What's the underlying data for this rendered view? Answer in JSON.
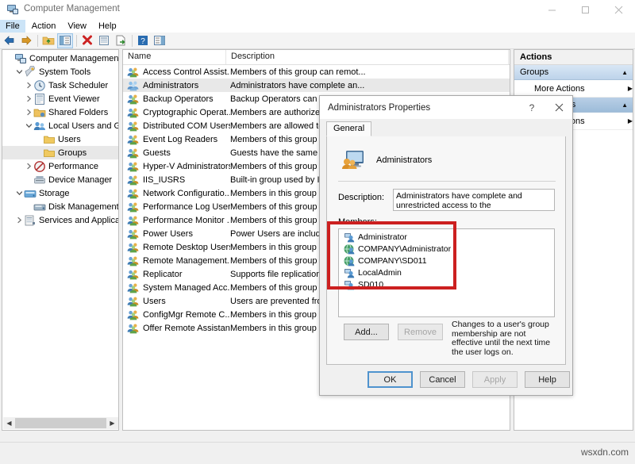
{
  "window": {
    "title": "Computer Management",
    "icon": "computer-management-icon",
    "minimize": "—",
    "maximize": "□",
    "close": "✕"
  },
  "menubar": {
    "items": [
      {
        "label": "File",
        "active": true
      },
      {
        "label": "Action",
        "active": false
      },
      {
        "label": "View",
        "active": false
      },
      {
        "label": "Help",
        "active": false
      }
    ]
  },
  "toolbar": {
    "buttons": [
      {
        "name": "back-icon"
      },
      {
        "name": "forward-icon"
      },
      {
        "name": "up-folder-icon"
      },
      {
        "name": "show-hide-console-tree-icon"
      },
      {
        "name": "delete-icon"
      },
      {
        "name": "properties-icon"
      },
      {
        "name": "export-list-icon"
      },
      {
        "name": "help-icon"
      },
      {
        "name": "show-action-pane-icon"
      }
    ]
  },
  "tree": {
    "nodes": [
      {
        "label": "Computer Management (Local",
        "depth": 0,
        "twisty": "none",
        "icon": "computer-icon",
        "selected": false
      },
      {
        "label": "System Tools",
        "depth": 1,
        "twisty": "expanded",
        "icon": "tools-icon",
        "selected": false
      },
      {
        "label": "Task Scheduler",
        "depth": 2,
        "twisty": "collapsed",
        "icon": "clock-icon",
        "selected": false
      },
      {
        "label": "Event Viewer",
        "depth": 2,
        "twisty": "collapsed",
        "icon": "event-viewer-icon",
        "selected": false
      },
      {
        "label": "Shared Folders",
        "depth": 2,
        "twisty": "collapsed",
        "icon": "shared-folders-icon",
        "selected": false
      },
      {
        "label": "Local Users and Groups",
        "depth": 2,
        "twisty": "expanded",
        "icon": "users-groups-icon",
        "selected": false
      },
      {
        "label": "Users",
        "depth": 3,
        "twisty": "none",
        "icon": "folder-icon",
        "selected": false
      },
      {
        "label": "Groups",
        "depth": 3,
        "twisty": "none",
        "icon": "folder-icon",
        "selected": true
      },
      {
        "label": "Performance",
        "depth": 2,
        "twisty": "collapsed",
        "icon": "performance-icon",
        "selected": false
      },
      {
        "label": "Device Manager",
        "depth": 2,
        "twisty": "none",
        "icon": "device-manager-icon",
        "selected": false
      },
      {
        "label": "Storage",
        "depth": 1,
        "twisty": "expanded",
        "icon": "storage-icon",
        "selected": false
      },
      {
        "label": "Disk Management",
        "depth": 2,
        "twisty": "none",
        "icon": "disk-management-icon",
        "selected": false
      },
      {
        "label": "Services and Applications",
        "depth": 1,
        "twisty": "collapsed",
        "icon": "services-icon",
        "selected": false
      }
    ]
  },
  "list": {
    "columns": [
      "Name",
      "Description"
    ],
    "rows": [
      {
        "name": "Access Control Assist...",
        "desc": "Members of this group can remot...",
        "selected": false
      },
      {
        "name": "Administrators",
        "desc": "Administrators have complete an...",
        "selected": true
      },
      {
        "name": "Backup Operators",
        "desc": "Backup Operators can override s...",
        "selected": false
      },
      {
        "name": "Cryptographic Operat...",
        "desc": "Members are authorized to perfo...",
        "selected": false
      },
      {
        "name": "Distributed COM Users",
        "desc": "Members are allowed to launch, ...",
        "selected": false
      },
      {
        "name": "Event Log Readers",
        "desc": "Members of this group can read ...",
        "selected": false
      },
      {
        "name": "Guests",
        "desc": "Guests have the same access as ...",
        "selected": false
      },
      {
        "name": "Hyper-V Administrators",
        "desc": "Members of this group have com...",
        "selected": false
      },
      {
        "name": "IIS_IUSRS",
        "desc": "Built-in group used by Internet I...",
        "selected": false
      },
      {
        "name": "Network Configuratio...",
        "desc": "Members in this group can have ...",
        "selected": false
      },
      {
        "name": "Performance Log Users",
        "desc": "Members of this group may sche...",
        "selected": false
      },
      {
        "name": "Performance Monitor ...",
        "desc": "Members of this group can acces...",
        "selected": false
      },
      {
        "name": "Power Users",
        "desc": "Power Users are included for bac...",
        "selected": false
      },
      {
        "name": "Remote Desktop Users",
        "desc": "Members in this group are grant...",
        "selected": false
      },
      {
        "name": "Remote Management...",
        "desc": "Members of this group can acces...",
        "selected": false
      },
      {
        "name": "Replicator",
        "desc": "Supports file replication in a do...",
        "selected": false
      },
      {
        "name": "System Managed Acc...",
        "desc": "Members of this group are mana...",
        "selected": false
      },
      {
        "name": "Users",
        "desc": "Users are prevented from makin...",
        "selected": false
      },
      {
        "name": "ConfigMgr Remote C...",
        "desc": "Members in this group can rem...",
        "selected": false
      },
      {
        "name": "Offer Remote Assistan...",
        "desc": "Members in this group can offe...",
        "selected": false
      }
    ]
  },
  "actions": {
    "title": "Actions",
    "sections": [
      {
        "label": "Groups",
        "more_actions": "More Actions"
      },
      {
        "label": "Administrators",
        "more_actions": "More Actions"
      }
    ]
  },
  "dialog": {
    "title": "Administrators Properties",
    "help_btn": "?",
    "close_btn": "✕",
    "tab": "General",
    "group_name": "Administrators",
    "description_label": "Description:",
    "description_value": "Administrators have complete and unrestricted access to the computer/domain",
    "members_label": "Members:",
    "members": [
      {
        "name": "Administrator",
        "icon": "local-user-icon"
      },
      {
        "name": "COMPANY\\Administrator",
        "icon": "domain-user-icon"
      },
      {
        "name": "COMPANY\\SD011",
        "icon": "domain-user-icon"
      },
      {
        "name": "LocalAdmin",
        "icon": "local-user-icon"
      },
      {
        "name": "SD010",
        "icon": "local-user-icon"
      }
    ],
    "add_button": "Add...",
    "remove_button": "Remove",
    "note": "Changes to a user's group membership are not effective until the next time the user logs on.",
    "ok_button": "OK",
    "cancel_button": "Cancel",
    "apply_button": "Apply",
    "help_button": "Help"
  },
  "annotation": {
    "color": "#cc2020",
    "target": "members-list"
  },
  "watermark": "wsxdn.com"
}
